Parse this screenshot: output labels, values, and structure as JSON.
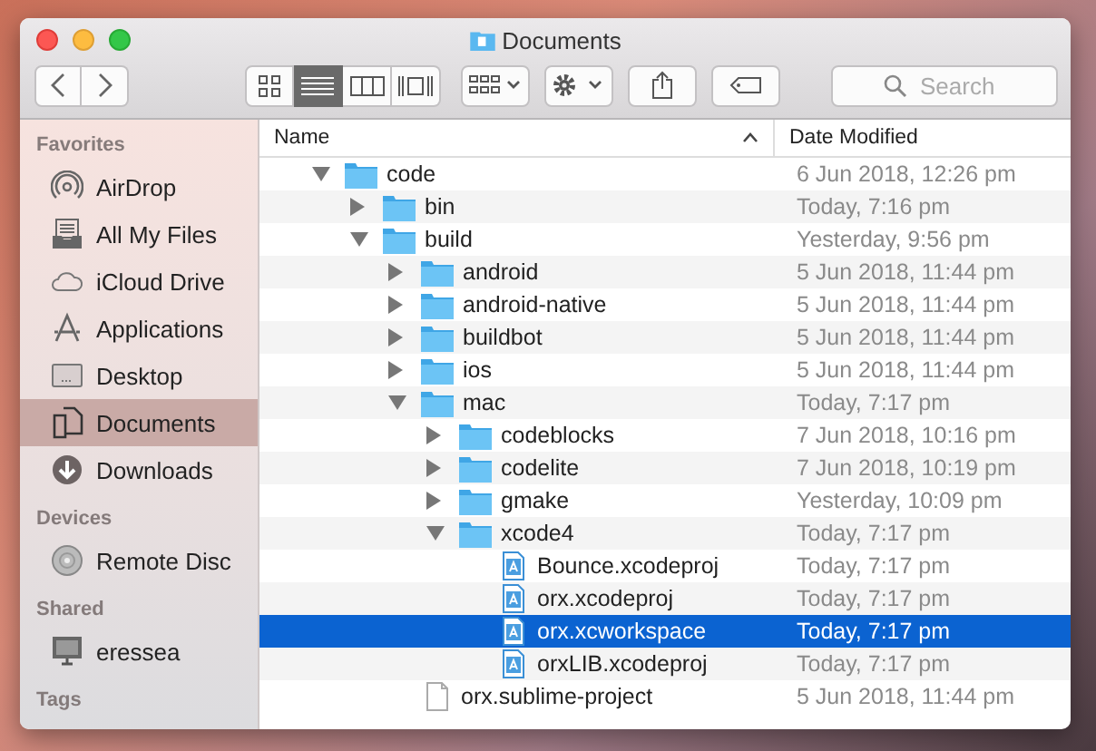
{
  "window": {
    "title": "Documents"
  },
  "toolbar": {
    "view_modes": [
      {
        "selected": false
      },
      {
        "selected": true
      },
      {
        "selected": false
      },
      {
        "selected": false
      }
    ],
    "search": {
      "placeholder": "Search"
    }
  },
  "sidebar": {
    "sections": [
      {
        "heading": "Favorites",
        "items": [
          {
            "label": "AirDrop",
            "selected": false
          },
          {
            "label": "All My Files",
            "selected": false
          },
          {
            "label": "iCloud Drive",
            "selected": false
          },
          {
            "label": "Applications",
            "selected": false
          },
          {
            "label": "Desktop",
            "selected": false
          },
          {
            "label": "Documents",
            "selected": true
          },
          {
            "label": "Downloads",
            "selected": false
          }
        ]
      },
      {
        "heading": "Devices",
        "items": [
          {
            "label": "Remote Disc",
            "selected": false
          }
        ]
      },
      {
        "heading": "Shared",
        "items": [
          {
            "label": "eressea",
            "selected": false
          }
        ]
      },
      {
        "heading": "Tags"
      }
    ]
  },
  "file_list": {
    "columns": [
      {
        "label": "Name",
        "sorted": true
      },
      {
        "label": "Date Modified",
        "sorted": false
      }
    ],
    "items": [
      {
        "kind": "folder",
        "name": "code",
        "date": "6 Jun 2018, 12:26 pm",
        "expanded": true,
        "selected": false,
        "children": [
          {
            "kind": "folder",
            "name": "bin",
            "date": "Today, 7:16 pm",
            "expanded": false,
            "selected": false
          },
          {
            "kind": "folder",
            "name": "build",
            "date": "Yesterday, 9:56 pm",
            "expanded": true,
            "selected": false,
            "children": [
              {
                "kind": "folder",
                "name": "android",
                "date": "5 Jun 2018, 11:44 pm",
                "expanded": false,
                "selected": false
              },
              {
                "kind": "folder",
                "name": "android-native",
                "date": "5 Jun 2018, 11:44 pm",
                "expanded": false,
                "selected": false
              },
              {
                "kind": "folder",
                "name": "buildbot",
                "date": "5 Jun 2018, 11:44 pm",
                "expanded": false,
                "selected": false
              },
              {
                "kind": "folder",
                "name": "ios",
                "date": "5 Jun 2018, 11:44 pm",
                "expanded": false,
                "selected": false
              },
              {
                "kind": "folder",
                "name": "mac",
                "date": "Today, 7:17 pm",
                "expanded": true,
                "selected": false,
                "children": [
                  {
                    "kind": "folder",
                    "name": "codeblocks",
                    "date": "7 Jun 2018, 10:16 pm",
                    "expanded": false,
                    "selected": false
                  },
                  {
                    "kind": "folder",
                    "name": "codelite",
                    "date": "7 Jun 2018, 10:19 pm",
                    "expanded": false,
                    "selected": false
                  },
                  {
                    "kind": "folder",
                    "name": "gmake",
                    "date": "Yesterday, 10:09 pm",
                    "expanded": false,
                    "selected": false
                  },
                  {
                    "kind": "folder",
                    "name": "xcode4",
                    "date": "Today, 7:17 pm",
                    "expanded": true,
                    "selected": false,
                    "children": [
                      {
                        "kind": "xcode",
                        "name": "Bounce.xcodeproj",
                        "date": "Today, 7:17 pm",
                        "selected": false
                      },
                      {
                        "kind": "xcode",
                        "name": "orx.xcodeproj",
                        "date": "Today, 7:17 pm",
                        "selected": false
                      },
                      {
                        "kind": "xcode",
                        "name": "orx.xcworkspace",
                        "date": "Today, 7:17 pm",
                        "selected": true
                      },
                      {
                        "kind": "xcode",
                        "name": "orxLIB.xcodeproj",
                        "date": "Today, 7:17 pm",
                        "selected": false
                      }
                    ]
                  }
                ]
              },
              {
                "kind": "file",
                "name": "orx.sublime-project",
                "date": "5 Jun 2018, 11:44 pm",
                "selected": false
              }
            ]
          }
        ]
      }
    ]
  }
}
